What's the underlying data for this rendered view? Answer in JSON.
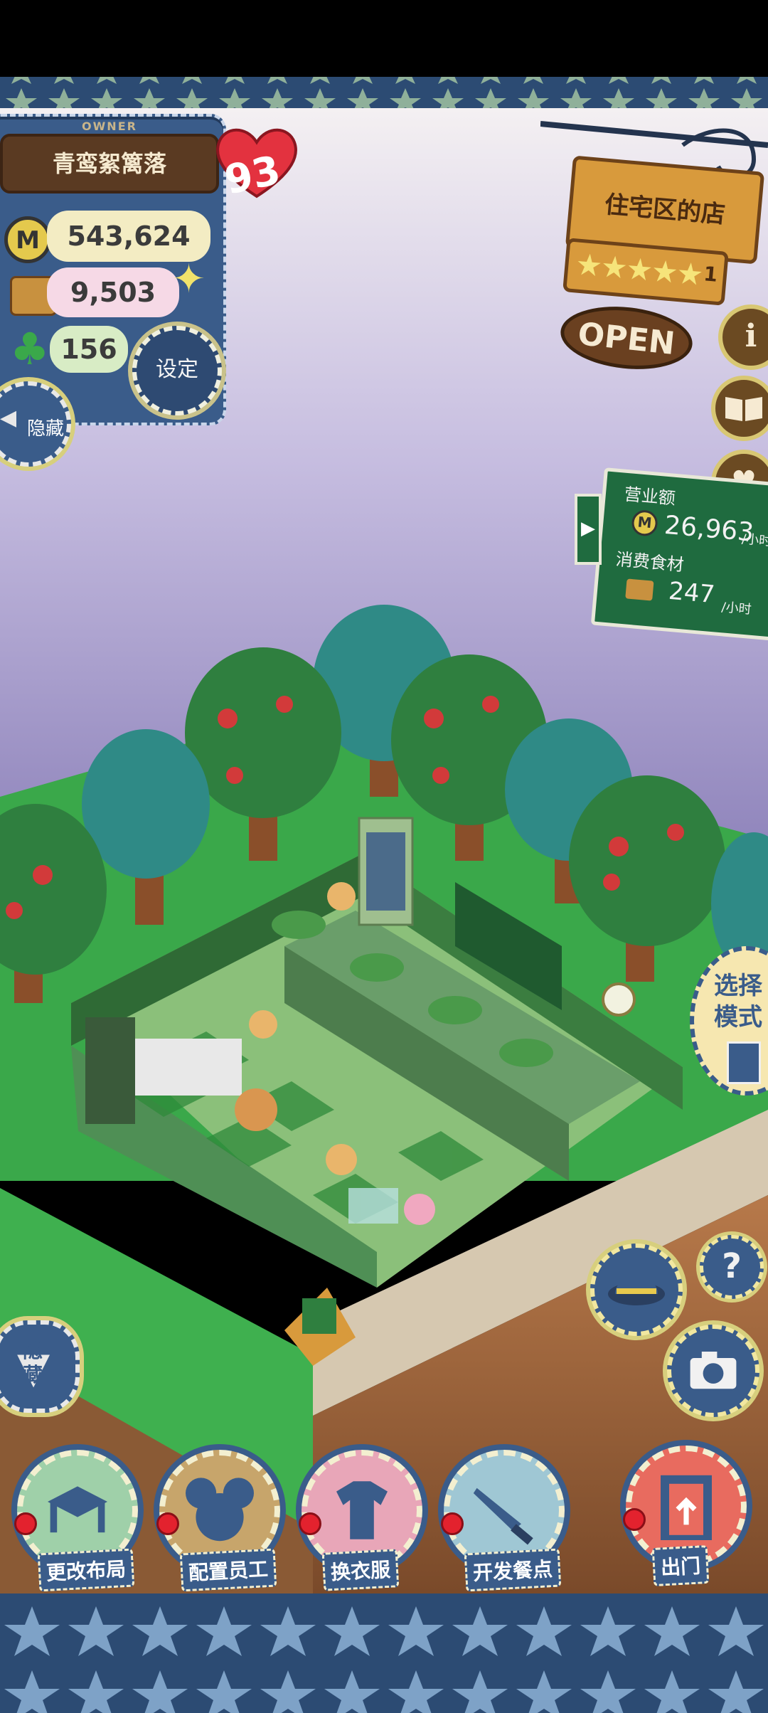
{
  "owner": {
    "caption": "OWNER",
    "name": "青鸾絮篱落",
    "level": "93",
    "money": "543,624",
    "ingredients": "9,503",
    "clover": "156",
    "coin_symbol": "M"
  },
  "buttons": {
    "settings": "设定",
    "hide_top": "隐藏",
    "hide_bottom": "隐藏",
    "select_mode": "选择模式"
  },
  "shop": {
    "name": "住宅区的店",
    "stars": 5,
    "star_level": "1",
    "status": "OPEN",
    "info_icon": "i"
  },
  "sales": {
    "revenue_label": "营业额",
    "revenue_value": "26,963",
    "revenue_unit": "/小时",
    "consumption_label": "消费食材",
    "consumption_value": "247",
    "consumption_unit": "/小时"
  },
  "menu": [
    {
      "label": "更改布局",
      "icon": "table-icon",
      "color": "#9fd0a9"
    },
    {
      "label": "配置员工",
      "icon": "mouse-icon",
      "color": "#c7a56b"
    },
    {
      "label": "换衣服",
      "icon": "shirt-icon",
      "color": "#e8a6b8"
    },
    {
      "label": "开发餐点",
      "icon": "knife-icon",
      "color": "#9fc7d4"
    },
    {
      "label": "出门",
      "icon": "door-icon",
      "color": "#e86b5f"
    }
  ],
  "colors": {
    "denim": "#3a5c8a",
    "grass": "#3aa84a",
    "sky": "#a99ccc",
    "board": "#1f6b3f"
  }
}
